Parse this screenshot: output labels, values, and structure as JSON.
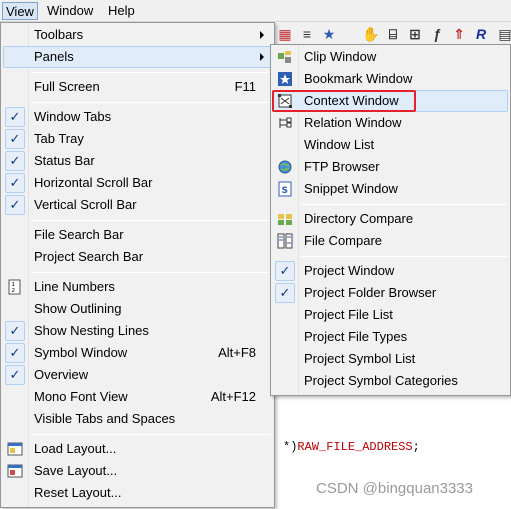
{
  "menubar": {
    "items": [
      "View",
      "Window",
      "Help"
    ]
  },
  "view_menu": {
    "toolbars": "Toolbars",
    "panels": "Panels",
    "full_screen": "Full Screen",
    "full_screen_shortcut": "F11",
    "window_tabs": "Window Tabs",
    "tab_tray": "Tab Tray",
    "status_bar": "Status Bar",
    "horizontal_scroll_bar": "Horizontal Scroll Bar",
    "vertical_scroll_bar": "Vertical Scroll Bar",
    "file_search_bar": "File Search Bar",
    "project_search_bar": "Project Search Bar",
    "line_numbers": "Line Numbers",
    "show_outlining": "Show Outlining",
    "show_nesting_lines": "Show Nesting Lines",
    "symbol_window": "Symbol Window",
    "symbol_window_shortcut": "Alt+F8",
    "overview": "Overview",
    "mono_font_view": "Mono Font View",
    "mono_font_view_shortcut": "Alt+F12",
    "visible_tabs_and_spaces": "Visible Tabs and Spaces",
    "load_layout": "Load Layout...",
    "save_layout": "Save Layout...",
    "reset_layout": "Reset Layout..."
  },
  "panels_menu": {
    "clip_window": "Clip Window",
    "bookmark_window": "Bookmark Window",
    "context_window": "Context Window",
    "relation_window": "Relation Window",
    "window_list": "Window List",
    "ftp_browser": "FTP Browser",
    "snippet_window": "Snippet Window",
    "directory_compare": "Directory Compare",
    "file_compare": "File Compare",
    "project_window": "Project Window",
    "project_folder_browser": "Project Folder Browser",
    "project_file_list": "Project File List",
    "project_file_types": "Project File Types",
    "project_symbol_list": "Project Symbol List",
    "project_symbol_categories": "Project Symbol Categories"
  },
  "check_glyph": "✓",
  "code": {
    "paren": "*)",
    "const": "RAW_FILE_ADDRESS",
    "semi": ";"
  },
  "watermark": "CSDN @bingquan3333",
  "colors": {
    "highlight_border": "#e5202b",
    "check_color": "#0b3a8c",
    "hover_bg": "#e1ecfa"
  }
}
